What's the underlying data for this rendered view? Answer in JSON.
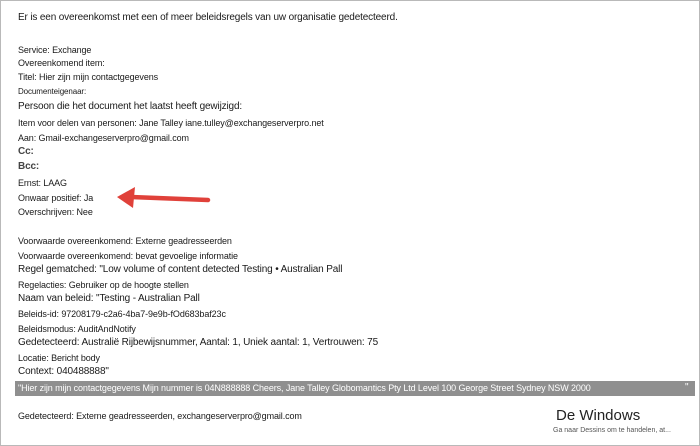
{
  "lines": {
    "intro": "Er is een overeenkomst met een of meer beleidsregels van uw organisatie gedetecteerd.",
    "service": "Service: Exchange",
    "item": "Overeenkomend item:",
    "titel": "Titel: Hier zijn mijn contactgegevens",
    "eigenaar": "Documenteigenaar:",
    "laatst": "Persoon die het document het laatst heeft gewijzigd:",
    "delen": "Item voor delen van personen: Jane Talley iane.tulley@exchangeserverpro.net",
    "aan": "Aan: Gmail-exchangeserverpro@gmail.com",
    "cc": "Cc:",
    "bcc": "Bcc:",
    "ernst": "Ernst: LAAG",
    "onwaar": "Onwaar positief: Ja",
    "overschrijven": "Overschrijven: Nee",
    "voorwaarde1": "Voorwaarde overeenkomend: Externe geadresseerden",
    "voorwaarde2": "Voorwaarde overeenkomend: bevat gevoelige informatie",
    "regel": "Regel gematched: \"Low volume of content detected Testing • Australian Pall",
    "acties": "Regelacties: Gebruiker op de hoogte stellen",
    "naam": "Naam van beleid: \"Testing - Australian Pall",
    "beleidsid": "Beleids-id: 97208179-c2a6-4ba7-9e9b-fOd683baf23c",
    "modus": "Beleidsmodus: AuditAndNotify",
    "gedetecteerd": "Gedetecteerd: Australië Rijbewijsnummer, Aantal: 1, Uniek aantal: 1, Vertrouwen: 75",
    "locatie": "Locatie: Bericht body",
    "context": "Context: 040488888\"",
    "highlight": "\"Hier zijn mijn contactgegevens Mijn nummer is 04N888888 Cheers, Jane Talley Globomantics Pty Ltd Level 100 George Street Sydney NSW 2000",
    "highlight_end": "\"",
    "gedetecteerd2": "Gedetecteerd: Externe geadresseerden, exchangeserverpro@gmail.com"
  },
  "watermark": {
    "title": "De Windows",
    "subtitle": "Ga naar Dessins om te handelen, at..."
  },
  "colors": {
    "arrow": "#e0413a",
    "highlight_bg": "#8f8f8f"
  }
}
